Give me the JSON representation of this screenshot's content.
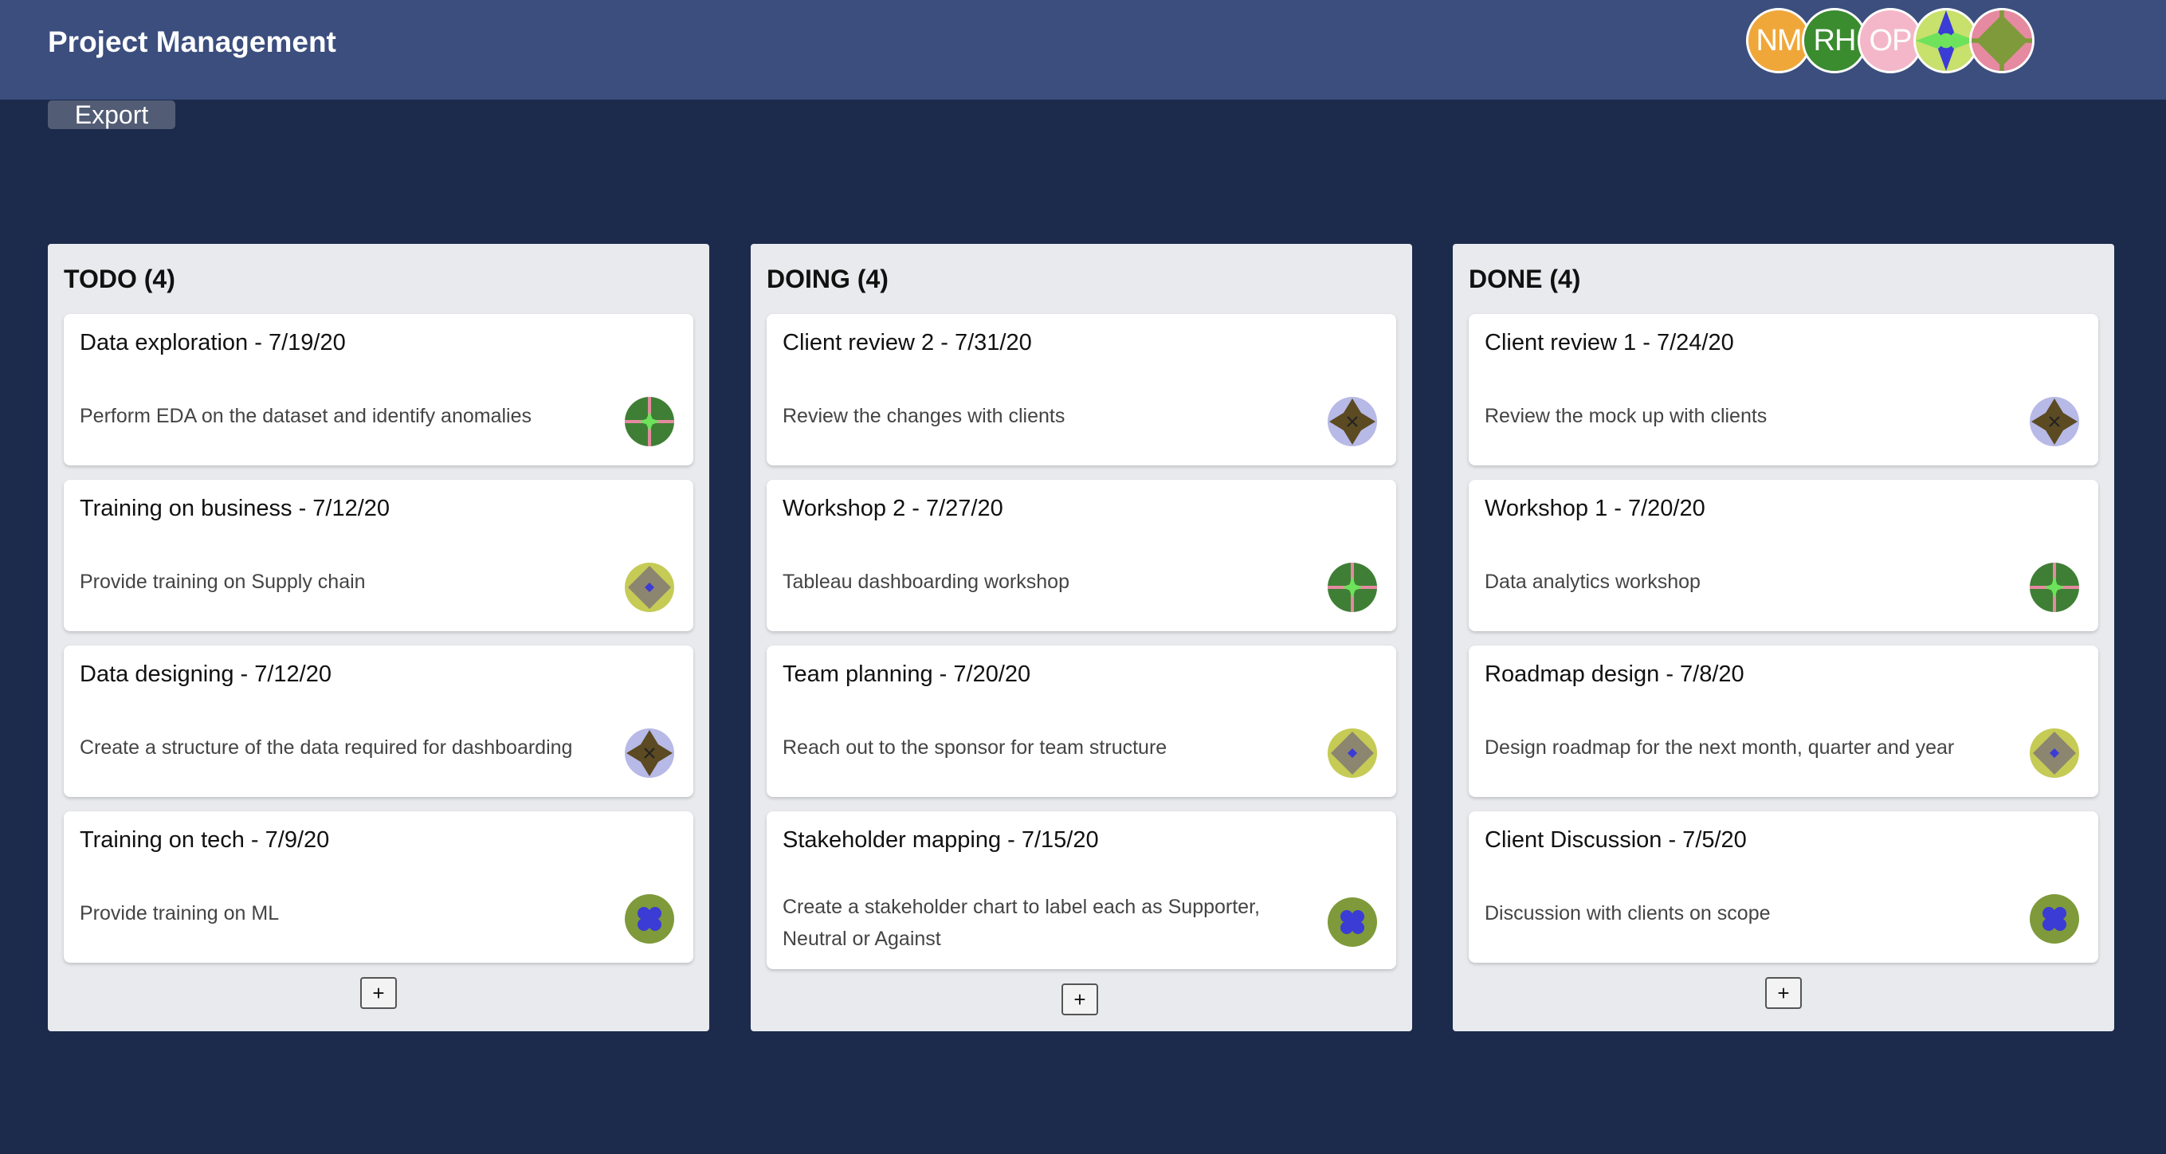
{
  "header": {
    "title": "Project Management",
    "export_label": "Export",
    "avatars": [
      {
        "initials": "NM",
        "color": "#f0a73a",
        "icon": "initials-avatar"
      },
      {
        "initials": "RH",
        "color": "#3a8c2f",
        "icon": "initials-avatar"
      },
      {
        "initials": "OP",
        "color": "#f4b7c9",
        "icon": "initials-avatar"
      },
      {
        "initials": "",
        "color": "#c8e06c",
        "icon": "pattern-avatar"
      },
      {
        "initials": "",
        "color": "#e58aa0",
        "icon": "pattern-avatar"
      }
    ]
  },
  "board": {
    "add_label": "+",
    "columns": [
      {
        "title": "TODO (4)",
        "cards": [
          {
            "title": "Data exploration - 7/19/20",
            "description": "Perform EDA on the dataset and identify anomalies"
          },
          {
            "title": "Training on business - 7/12/20",
            "description": "Provide training on Supply chain"
          },
          {
            "title": "Data designing - 7/12/20",
            "description": "Create a structure of the data required for dashboarding"
          },
          {
            "title": "Training on tech - 7/9/20",
            "description": "Provide training on ML"
          }
        ]
      },
      {
        "title": "DOING (4)",
        "cards": [
          {
            "title": "Client review 2 - 7/31/20",
            "description": "Review the changes with clients"
          },
          {
            "title": "Workshop 2 - 7/27/20",
            "description": "Tableau dashboarding workshop"
          },
          {
            "title": "Team planning - 7/20/20",
            "description": "Reach out to the sponsor for team structure"
          },
          {
            "title": "Stakeholder mapping - 7/15/20",
            "description": "Create a stakeholder chart to label each as Supporter, Neutral or Against"
          }
        ]
      },
      {
        "title": "DONE (4)",
        "cards": [
          {
            "title": "Client review 1 - 7/24/20",
            "description": "Review the mock up with clients"
          },
          {
            "title": "Workshop 1 - 7/20/20",
            "description": "Data analytics workshop"
          },
          {
            "title": "Roadmap design - 7/8/20",
            "description": "Design roadmap for the next month, quarter and year"
          },
          {
            "title": "Client Discussion - 7/5/20",
            "description": "Discussion with clients on scope"
          }
        ]
      }
    ]
  },
  "avatar_styles": {
    "green-cross": {
      "bg": "#3f7f35",
      "accent": "#e58aa0",
      "center": "#6fe25c"
    },
    "olive-diamond": {
      "bg": "#c5cb55",
      "accent": "#8c8570",
      "center": "#3b3bd6"
    },
    "brown-star": {
      "bg": "#b7b9e6",
      "accent": "#5b4a22",
      "center": "#222222"
    },
    "blue-clover": {
      "bg": "#7f9a3a",
      "accent": "#3b3bd6",
      "center": "#3b3bd6"
    }
  }
}
